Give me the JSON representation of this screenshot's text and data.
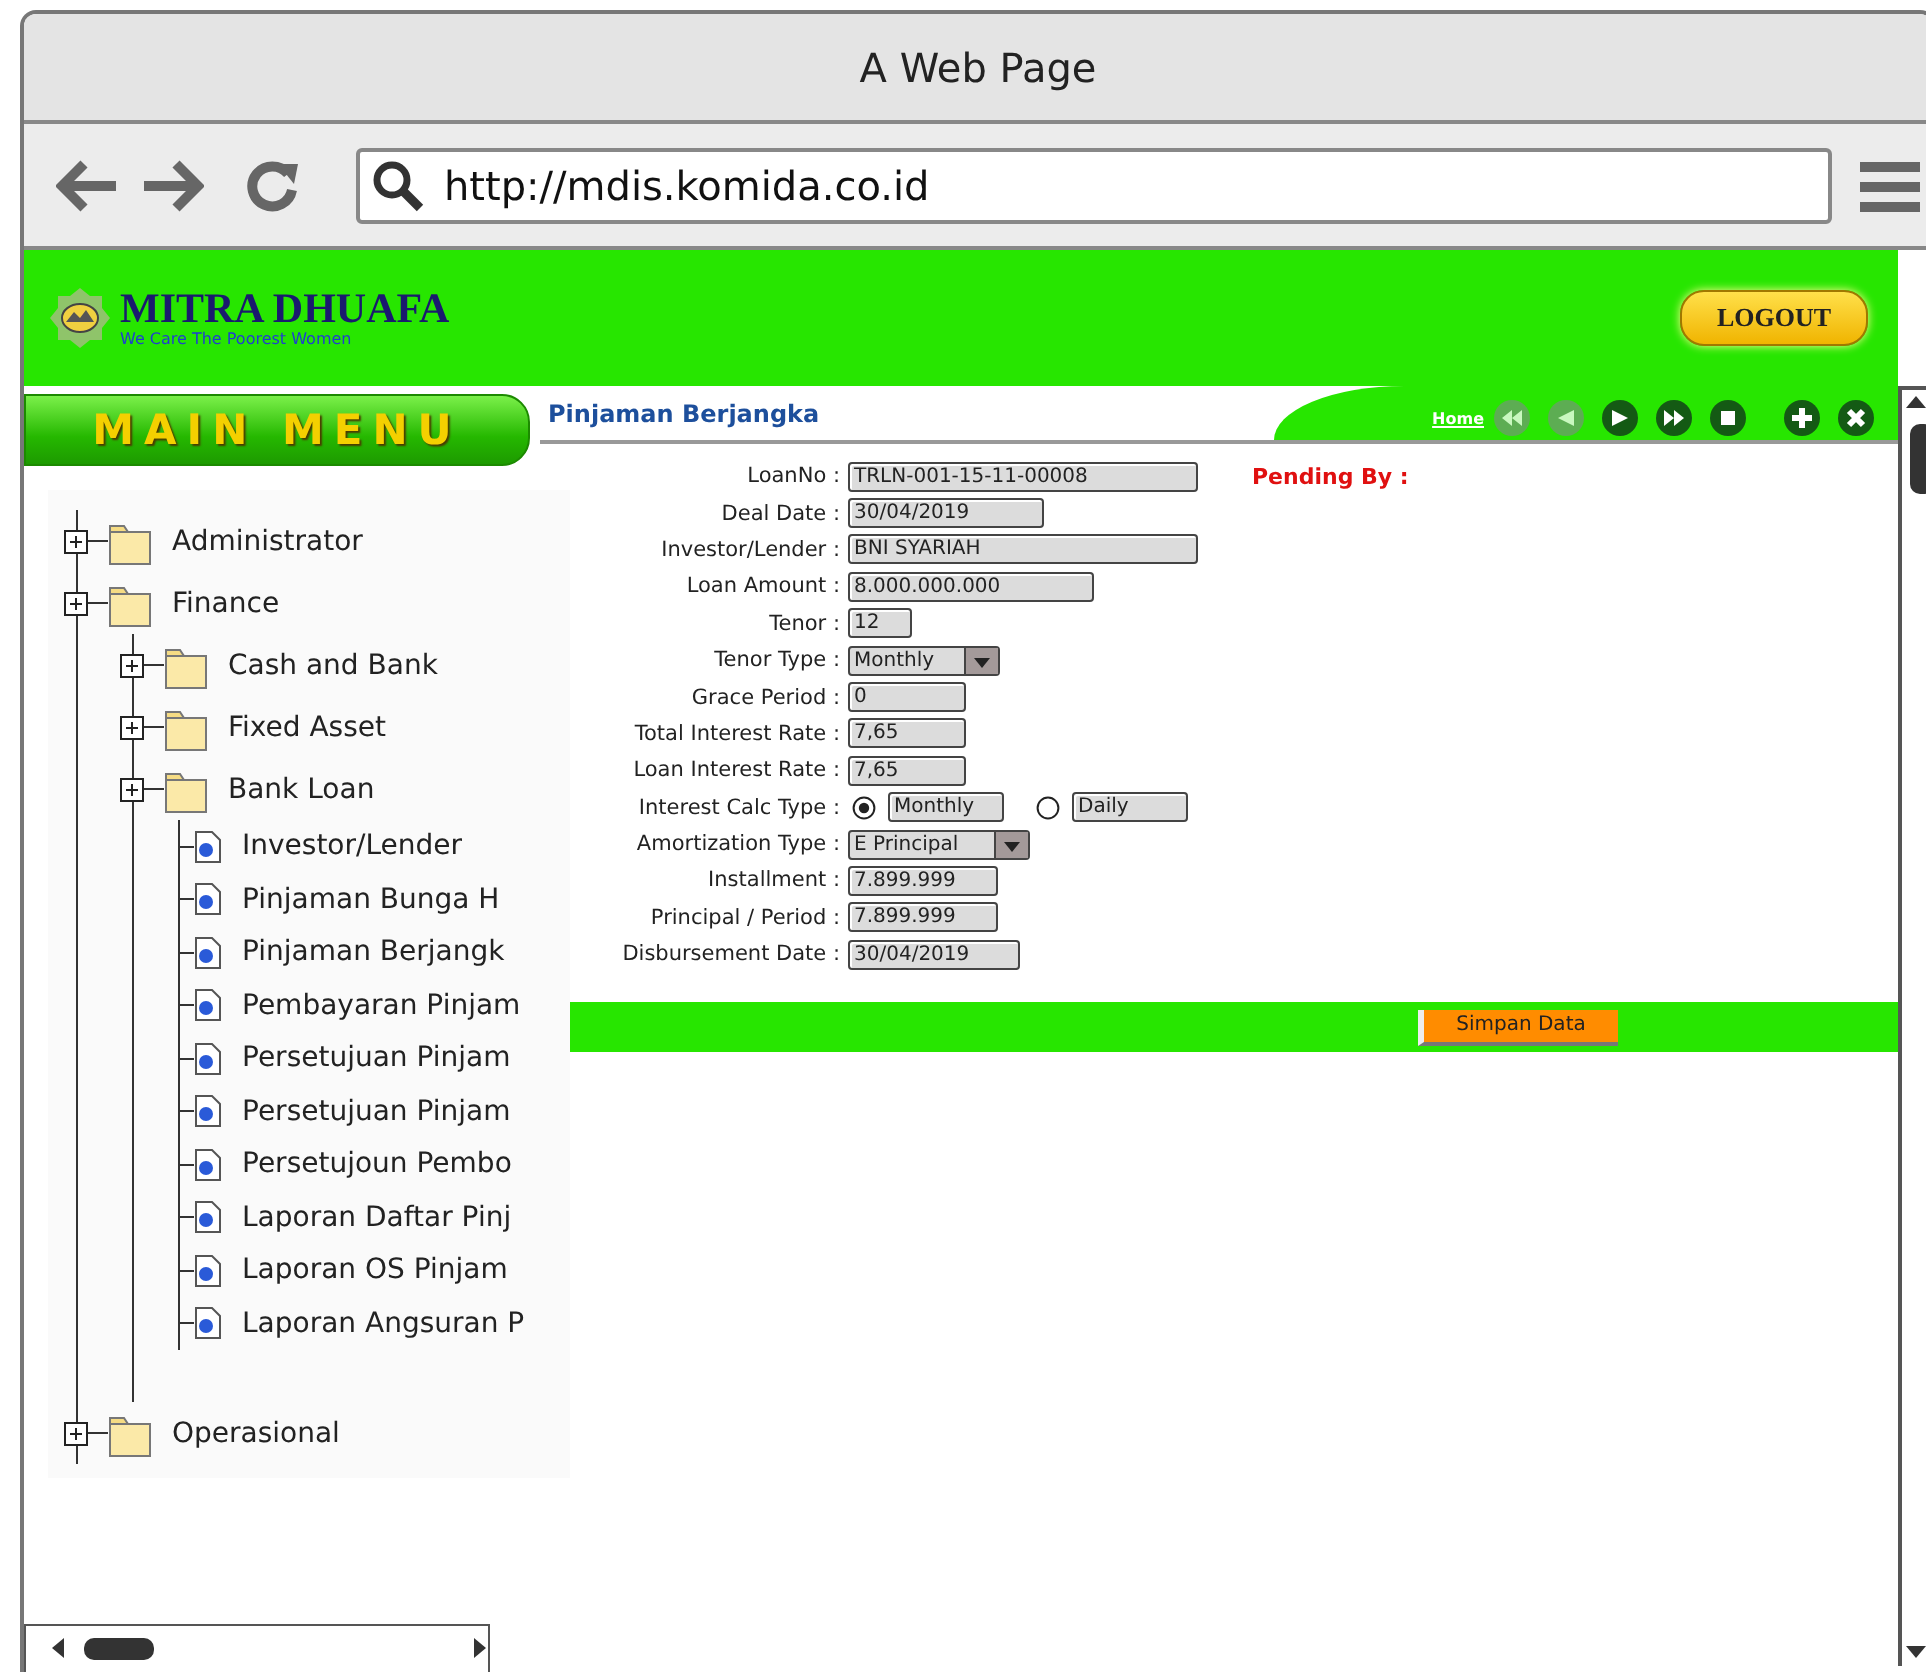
{
  "window": {
    "title": "A Web Page"
  },
  "address_bar": {
    "url": "http://mdis.komida.co.id"
  },
  "header": {
    "brand": "MITRA DHUAFA",
    "tagline": "We Care The Poorest Women",
    "logout": "LOGOUT"
  },
  "main_menu": {
    "title": "MAIN MENU",
    "tree": [
      {
        "kind": "folder",
        "label": "Administrator"
      },
      {
        "kind": "folder",
        "label": "Finance",
        "children": [
          {
            "kind": "folder",
            "label": "Cash and Bank"
          },
          {
            "kind": "folder",
            "label": "Fixed Asset"
          },
          {
            "kind": "folder",
            "label": "Bank Loan",
            "children": [
              {
                "kind": "page",
                "label": "Investor/Lender"
              },
              {
                "kind": "page",
                "label": "Pinjaman Bunga H"
              },
              {
                "kind": "page",
                "label": "Pinjaman Berjangk"
              },
              {
                "kind": "page",
                "label": "Pembayaran Pinjam"
              },
              {
                "kind": "page",
                "label": "Persetujuan Pinjam"
              },
              {
                "kind": "page",
                "label": "Persetujuan Pinjam"
              },
              {
                "kind": "page",
                "label": "Persetujoun Pembo"
              },
              {
                "kind": "page",
                "label": "Laporan Daftar Pinj"
              },
              {
                "kind": "page",
                "label": "Laporan OS Pinjam"
              },
              {
                "kind": "page",
                "label": "Laporan Angsuran P"
              }
            ]
          }
        ]
      },
      {
        "kind": "folder",
        "label": "Operasional"
      }
    ]
  },
  "page": {
    "title": "Pinjaman Berjangka",
    "home_link": "Home",
    "toolbar": [
      {
        "kind": "first",
        "disabled": true
      },
      {
        "kind": "prev",
        "disabled": true
      },
      {
        "kind": "next",
        "disabled": false
      },
      {
        "kind": "last",
        "disabled": false
      },
      {
        "kind": "stop",
        "disabled": false
      },
      {
        "kind": "add",
        "disabled": false
      },
      {
        "kind": "close",
        "disabled": false
      }
    ],
    "pending_by": "Pending By :",
    "fields": [
      {
        "kind": "text",
        "label": "LoanNo :",
        "value": "TRLN-001-15-11-00008"
      },
      {
        "kind": "text",
        "label": "Deal Date :",
        "value": "30/04/2019"
      },
      {
        "kind": "text",
        "label": "Investor/Lender :",
        "value": "BNI SYARIAH"
      },
      {
        "kind": "text",
        "label": "Loan Amount :",
        "value": "8.000.000.000"
      },
      {
        "kind": "text",
        "label": "Tenor :",
        "value": "12"
      },
      {
        "kind": "select",
        "label": "Tenor Type :",
        "value": "Monthly"
      },
      {
        "kind": "text",
        "label": "Grace Period :",
        "value": "0"
      },
      {
        "kind": "text",
        "label": "Total Interest Rate :",
        "value": "7,65"
      },
      {
        "kind": "text",
        "label": "Loan Interest Rate :",
        "value": "7,65"
      },
      {
        "kind": "radio",
        "label": "Interest Calc Type :",
        "options": [
          {
            "label": "Monthly",
            "selected": true
          },
          {
            "label": "Daily",
            "selected": false
          }
        ]
      },
      {
        "kind": "select",
        "label": "Amortization Type :",
        "value": "E Principal"
      },
      {
        "kind": "text",
        "label": "Installment :",
        "value": "7.899.999"
      },
      {
        "kind": "text",
        "label": "Principal / Period :",
        "value": "7.899.999"
      },
      {
        "kind": "text",
        "label": "Disbursement Date :",
        "value": "30/04/2019"
      }
    ],
    "save_button": "Simpan Data"
  }
}
